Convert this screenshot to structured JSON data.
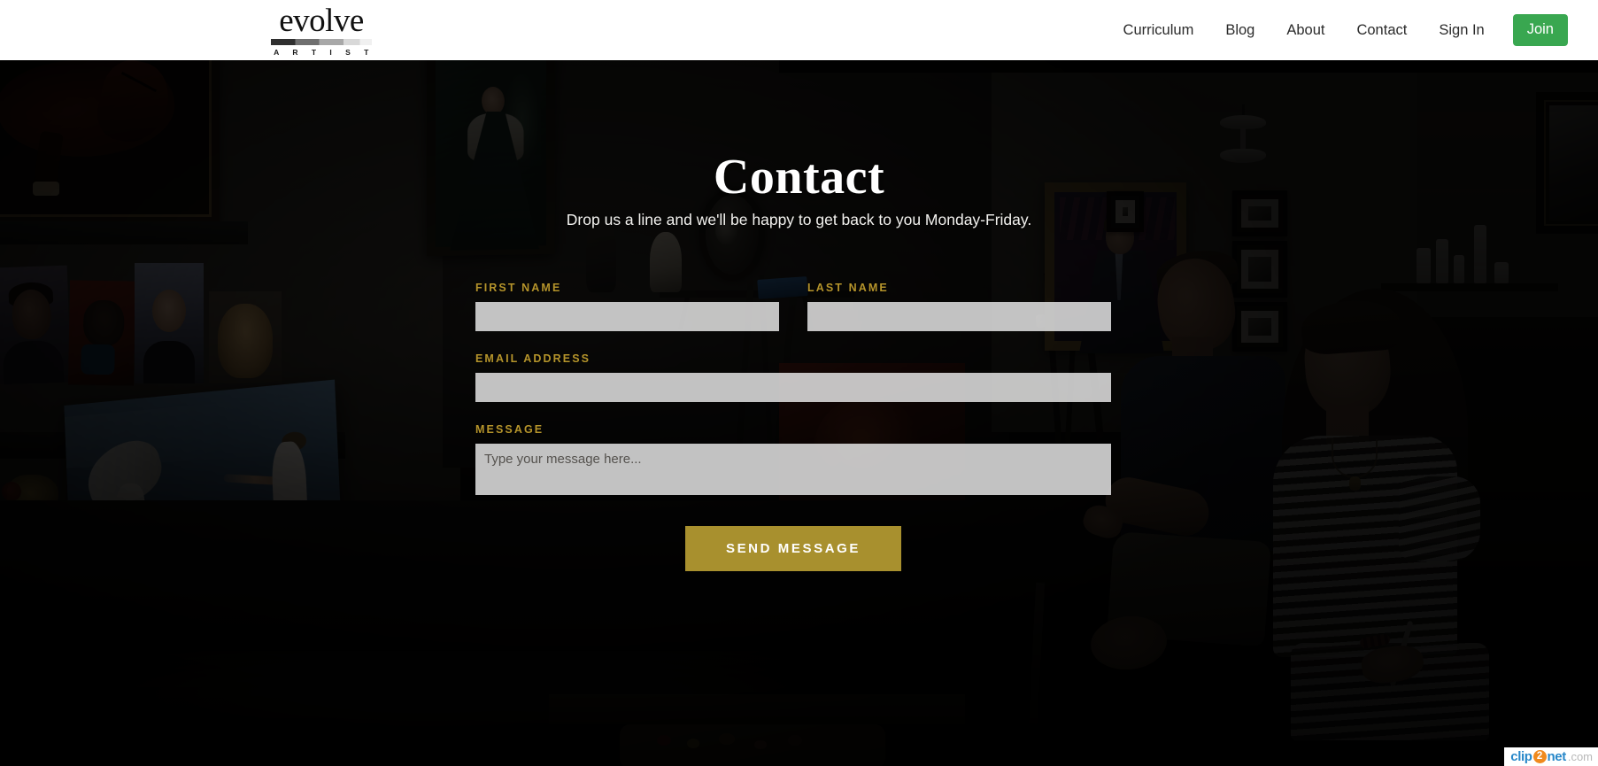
{
  "header": {
    "logo": {
      "word": "evolve",
      "subtitle": "A R T I S T",
      "bar_icon": "gradient-bar-icon"
    },
    "nav": [
      {
        "label": "Curriculum"
      },
      {
        "label": "Blog"
      },
      {
        "label": "About"
      },
      {
        "label": "Contact"
      },
      {
        "label": "Sign In"
      }
    ],
    "join_button": {
      "label": "Join",
      "color": "#39a750"
    }
  },
  "hero": {
    "title": "Contact",
    "subtitle": "Drop us a line and we'll be happy to get back to you Monday-Friday.",
    "background": "art-studio-instructor-and-student-photo"
  },
  "form": {
    "fields": {
      "first_name": {
        "label": "FIRST NAME",
        "value": "",
        "placeholder": ""
      },
      "last_name": {
        "label": "LAST NAME",
        "value": "",
        "placeholder": ""
      },
      "email": {
        "label": "EMAIL ADDRESS",
        "value": "",
        "placeholder": ""
      },
      "message": {
        "label": "MESSAGE",
        "value": "",
        "placeholder": "Type your message here..."
      }
    },
    "submit": {
      "label": "SEND MESSAGE",
      "color": "#a8902e"
    },
    "label_color": "#b5942b"
  },
  "watermark": {
    "clip": "clip",
    "two": "2",
    "net": "net",
    "com": ".com"
  }
}
